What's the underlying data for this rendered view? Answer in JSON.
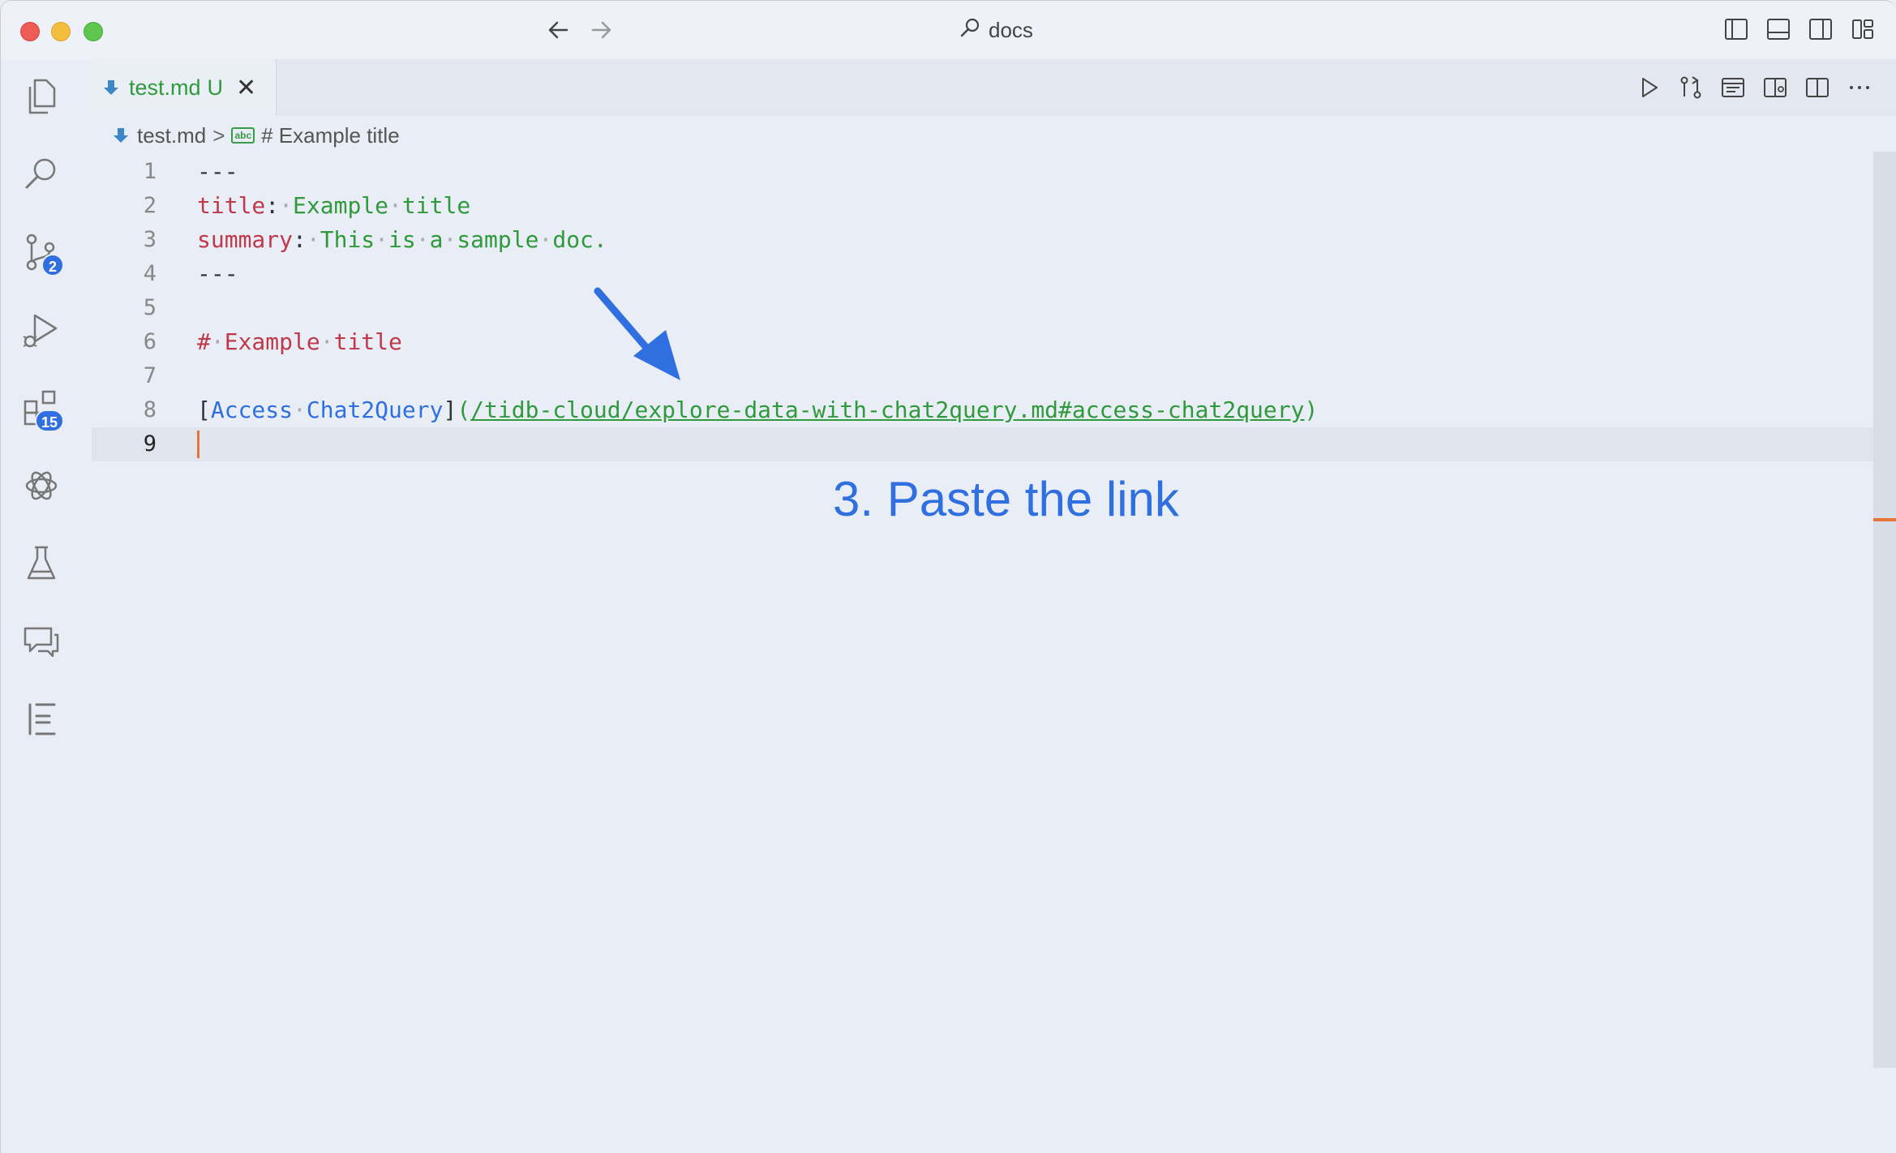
{
  "titlebar": {
    "search_text": "docs"
  },
  "activity_bar": {
    "items": [
      {
        "name": "explorer",
        "icon": "files-icon"
      },
      {
        "name": "search",
        "icon": "search-icon"
      },
      {
        "name": "source-control",
        "icon": "source-control-icon",
        "badge": "2"
      },
      {
        "name": "run-debug",
        "icon": "run-debug-icon"
      },
      {
        "name": "extensions",
        "icon": "extensions-icon",
        "badge": "15"
      },
      {
        "name": "chatgpt",
        "icon": "openai-icon"
      },
      {
        "name": "testing",
        "icon": "flask-icon"
      },
      {
        "name": "comments",
        "icon": "comments-icon"
      },
      {
        "name": "outline",
        "icon": "outline-icon"
      }
    ]
  },
  "tab": {
    "filename": "test.md",
    "status": "U",
    "close": "✕"
  },
  "breadcrumb": {
    "file": "test.md",
    "separator": ">",
    "symbol": "# Example title",
    "symbol_icon_text": "abc"
  },
  "editor": {
    "line_numbers": [
      "1",
      "2",
      "3",
      "4",
      "5",
      "6",
      "7",
      "8",
      "9"
    ],
    "current_line": 9,
    "line1": "---",
    "line2_key": "title",
    "line2_colon": ":",
    "line2_value_1": "Example",
    "line2_value_2": "title",
    "line3_key": "summary",
    "line3_colon": ":",
    "line3_words": [
      "This",
      "is",
      "a",
      "sample",
      "doc."
    ],
    "line4": "---",
    "line6_hash": "#",
    "line6_words": [
      "Example",
      "title"
    ],
    "line8_open_bracket": "[",
    "line8_text_1": "Access",
    "line8_text_2": "Chat2Query",
    "line8_close_bracket": "]",
    "line8_open_paren": "(",
    "line8_url": "/tidb-cloud/explore-data-with-chat2query.md#access-chat2query",
    "line8_close_paren": ")"
  },
  "annotation": {
    "text": "3. Paste the link",
    "color": "#2f6fe0"
  },
  "colors": {
    "accent_blue": "#2f6fe0",
    "yaml_key": "#c0394b",
    "string_green": "#2f9a3c",
    "cursor": "#e8743b"
  }
}
